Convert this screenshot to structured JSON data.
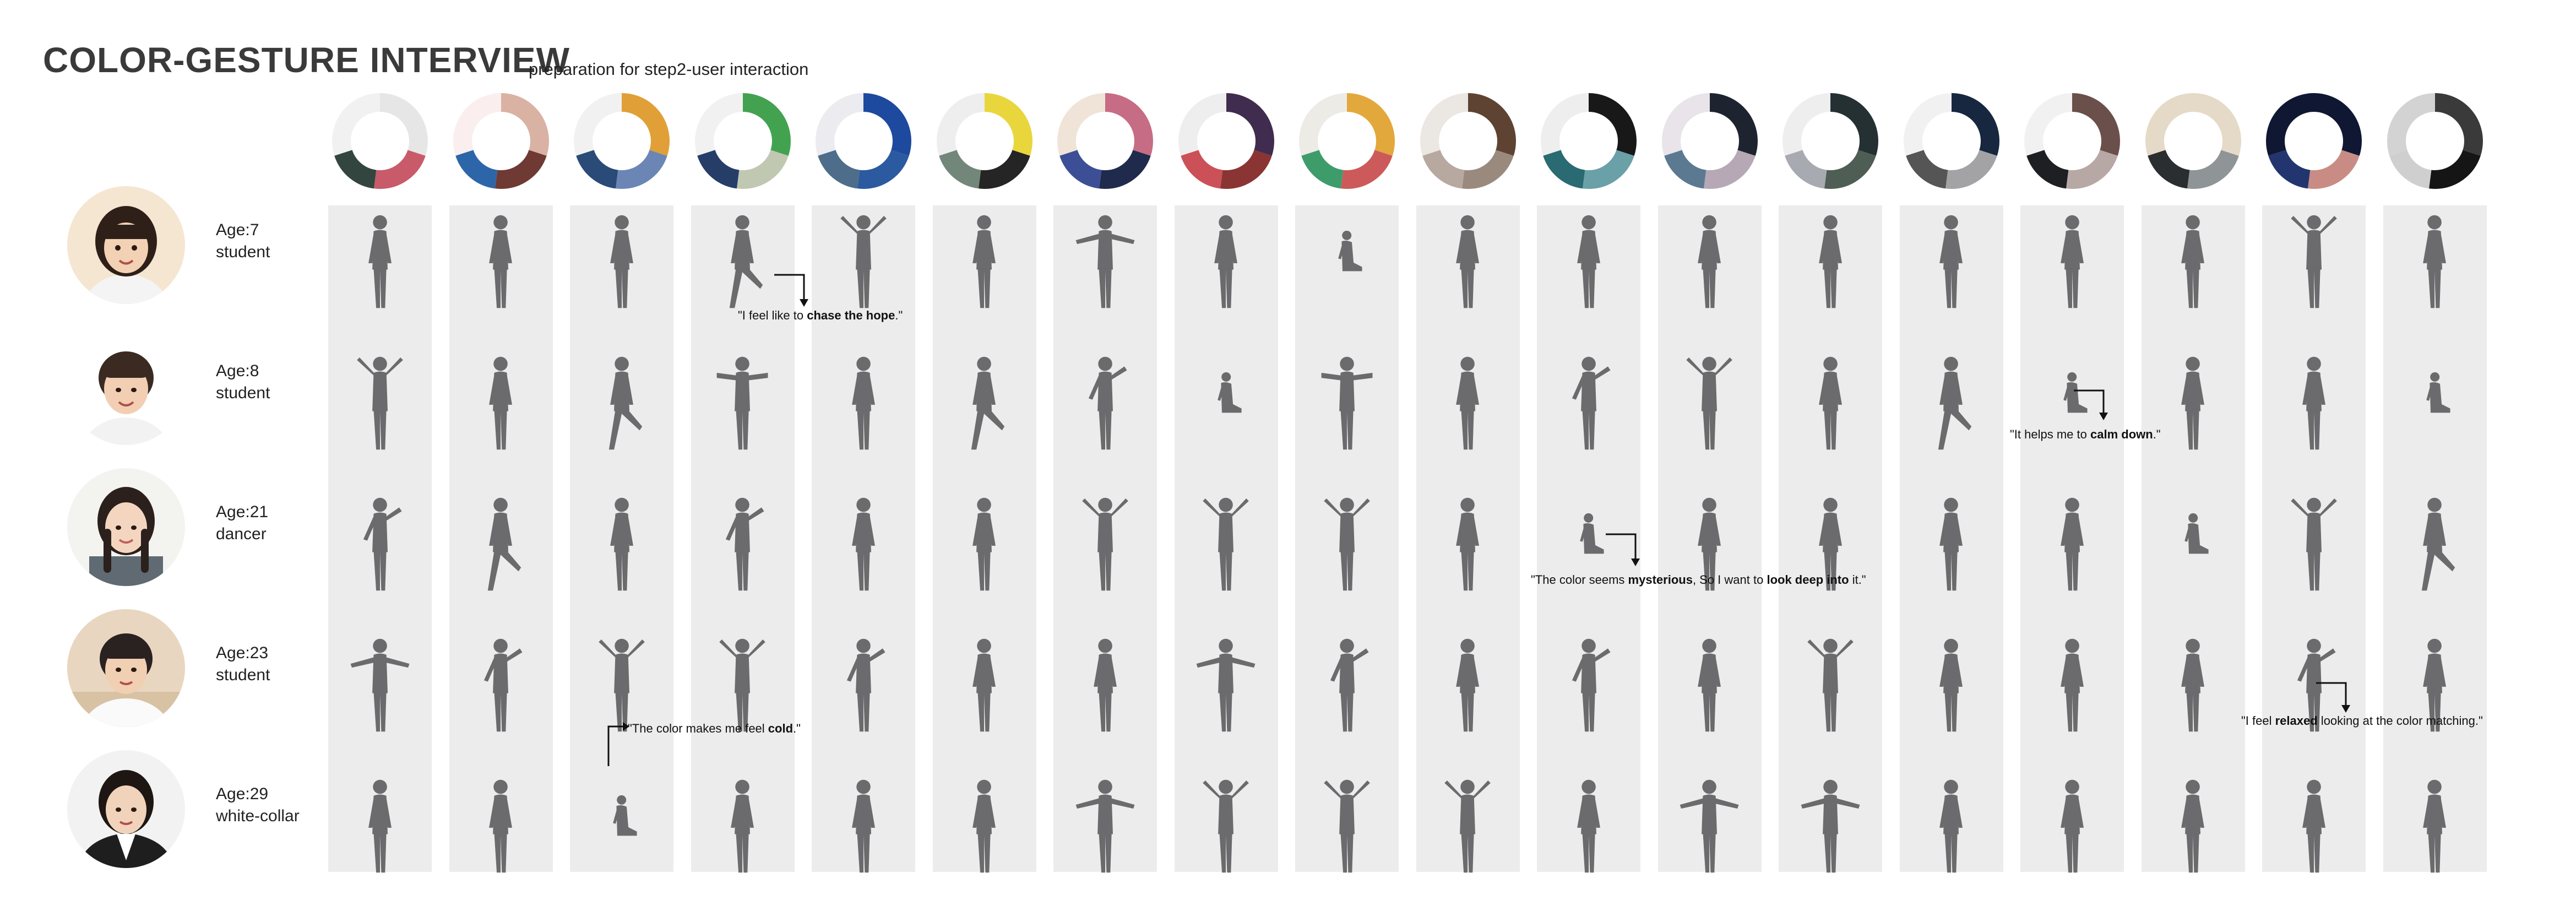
{
  "header": {
    "title": "COLOR-GESTURE INTERVIEW",
    "subtitle": "preparation for step2-user interaction"
  },
  "colors": {
    "silhouette": "#6b6b6d",
    "column_bg": "#ececec"
  },
  "color_schemes": [
    [
      "#e6e6e6",
      "#c85a6a",
      "#33453f",
      "#f1f1f1"
    ],
    [
      "#d9b2a3",
      "#6e3a33",
      "#2d66a8",
      "#faeeee"
    ],
    [
      "#e0a037",
      "#6b86b5",
      "#2a4a78",
      "#f1f1f1"
    ],
    [
      "#43a250",
      "#c0c8b1",
      "#263d68",
      "#f1f1f1"
    ],
    [
      "#1d4a9e",
      "#2b5aa0",
      "#4d6d8a",
      "#ebebf0"
    ],
    [
      "#e8d63c",
      "#252525",
      "#72877a",
      "#eeeeee"
    ],
    [
      "#c66c84",
      "#1f2a4c",
      "#3c4f96",
      "#f0e4d9"
    ],
    [
      "#3f2c4e",
      "#8b3434",
      "#cc5058",
      "#eeeeee"
    ],
    [
      "#e3a83c",
      "#cc5a5a",
      "#3e9c6b",
      "#ecebe6"
    ],
    [
      "#5e4232",
      "#9a8a7e",
      "#b7a8a0",
      "#ebe7e2"
    ],
    [
      "#181818",
      "#6aa0a8",
      "#2a6a72",
      "#eeeeee"
    ],
    [
      "#1d2430",
      "#b6a8b4",
      "#5b7a92",
      "#e8e4ea"
    ],
    [
      "#253033",
      "#4e5e55",
      "#a7aab0",
      "#eeeeee"
    ],
    [
      "#17273f",
      "#a3a3a6",
      "#555",
      "#f1f1f1"
    ],
    [
      "#6b4f4b",
      "#b8a8a5",
      "#1d1f22",
      "#f1f1f1"
    ],
    [
      "#e5dac7",
      "#8f9497",
      "#2a2e31",
      "#e5dac7"
    ],
    [
      "#0f1733",
      "#c98c84",
      "#22356e",
      "#0f1733"
    ],
    [
      "#3a3a3a",
      "#151515",
      "#cfcfcf",
      "#d3d3d3"
    ]
  ],
  "participants": [
    {
      "age": "Age:7",
      "occupation": "student"
    },
    {
      "age": "Age:8",
      "occupation": "student"
    },
    {
      "age": "Age:21",
      "occupation": "dancer"
    },
    {
      "age": "Age:23",
      "occupation": "student"
    },
    {
      "age": "Age:29",
      "occupation": "white-collar"
    }
  ],
  "quotes": [
    {
      "pre": "\"I feel like to ",
      "bold": "chase the hope",
      "post": ".\""
    },
    {
      "pre": "\"It helps me to ",
      "bold": "calm down",
      "post": ".\""
    },
    {
      "pre": "\"The color seems ",
      "bold": "mysterious",
      "mid": ", So I want to ",
      "bold2": "look deep into",
      "post": " it.\""
    },
    {
      "pre": "\"The color makes me feel ",
      "bold": "cold",
      "post": ".\""
    },
    {
      "pre": "\"I feel ",
      "bold": "relaxed",
      "post": " looking at the color matching.\""
    }
  ]
}
